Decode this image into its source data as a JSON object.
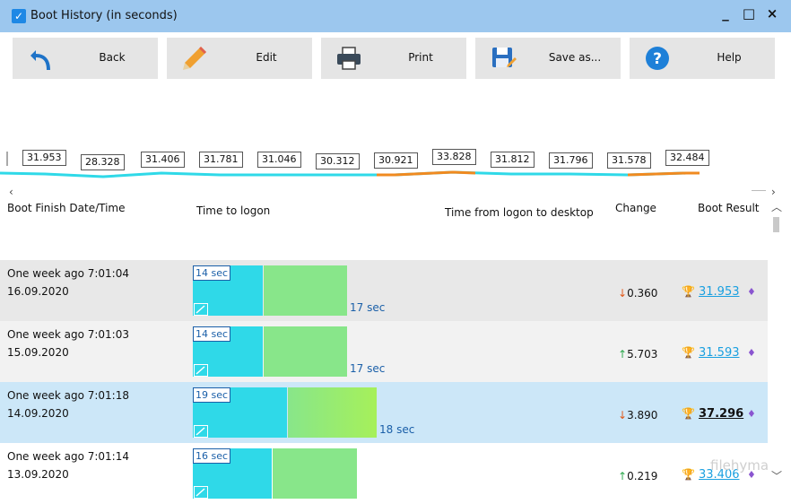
{
  "window": {
    "title": "Boot History (in seconds)",
    "minimize": "_",
    "maximize": "□",
    "close": "×"
  },
  "toolbar": {
    "back": "Back",
    "edit": "Edit",
    "print": "Print",
    "save_as": "Save as...",
    "help": "Help"
  },
  "history_strip": {
    "values": [
      "31.953",
      "28.328",
      "31.406",
      "31.781",
      "31.046",
      "30.312",
      "30.921",
      "33.828",
      "31.812",
      "31.796",
      "31.578",
      "32.484"
    ],
    "nav_left": "‹",
    "nav_right": "›"
  },
  "columns": {
    "date": "Boot Finish Date/Time",
    "logon": "Time to logon",
    "desktop": "Time from logon to desktop",
    "change": "Change",
    "result": "Boot Result"
  },
  "rows": [
    {
      "date1": "One week ago  7:01:04",
      "date2": "16.09.2020",
      "logon": "14 sec",
      "desktop": "17 sec",
      "logon_frac": 0.457,
      "desktop_frac": 0.547,
      "change_arrow": "↓",
      "change": "0.360",
      "result": "31.953",
      "highlight": false,
      "bg": "#e8e8e8"
    },
    {
      "date1": "One week ago  7:01:03",
      "date2": "15.09.2020",
      "logon": "14 sec",
      "desktop": "17 sec",
      "logon_frac": 0.457,
      "desktop_frac": 0.547,
      "change_arrow": "↑",
      "change": "5.703",
      "result": "31.593",
      "highlight": false,
      "bg": "#f2f2f2"
    },
    {
      "date1": "One week ago  7:01:18",
      "date2": "14.09.2020",
      "logon": "19 sec",
      "desktop": "18 sec",
      "logon_frac": 0.62,
      "desktop_frac": 0.58,
      "change_arrow": "↓",
      "change": "3.890",
      "result": "37.296",
      "highlight": true,
      "bg": "#cce7f8"
    },
    {
      "date1": "One week ago  7:01:14",
      "date2": "13.09.2020",
      "logon": "16 sec",
      "desktop": "",
      "logon_frac": 0.52,
      "desktop_frac": 0.55,
      "change_arrow": "↑",
      "change": "0.219",
      "result": "33.406",
      "highlight": false,
      "bg": "#ffffff"
    }
  ],
  "watermark": "filehyma",
  "colors": {
    "titlebar": "#9cc7ee",
    "logon_bar": "#2fd9e8",
    "desktop_bar": "#88e68a",
    "link": "#1aa0e0"
  }
}
